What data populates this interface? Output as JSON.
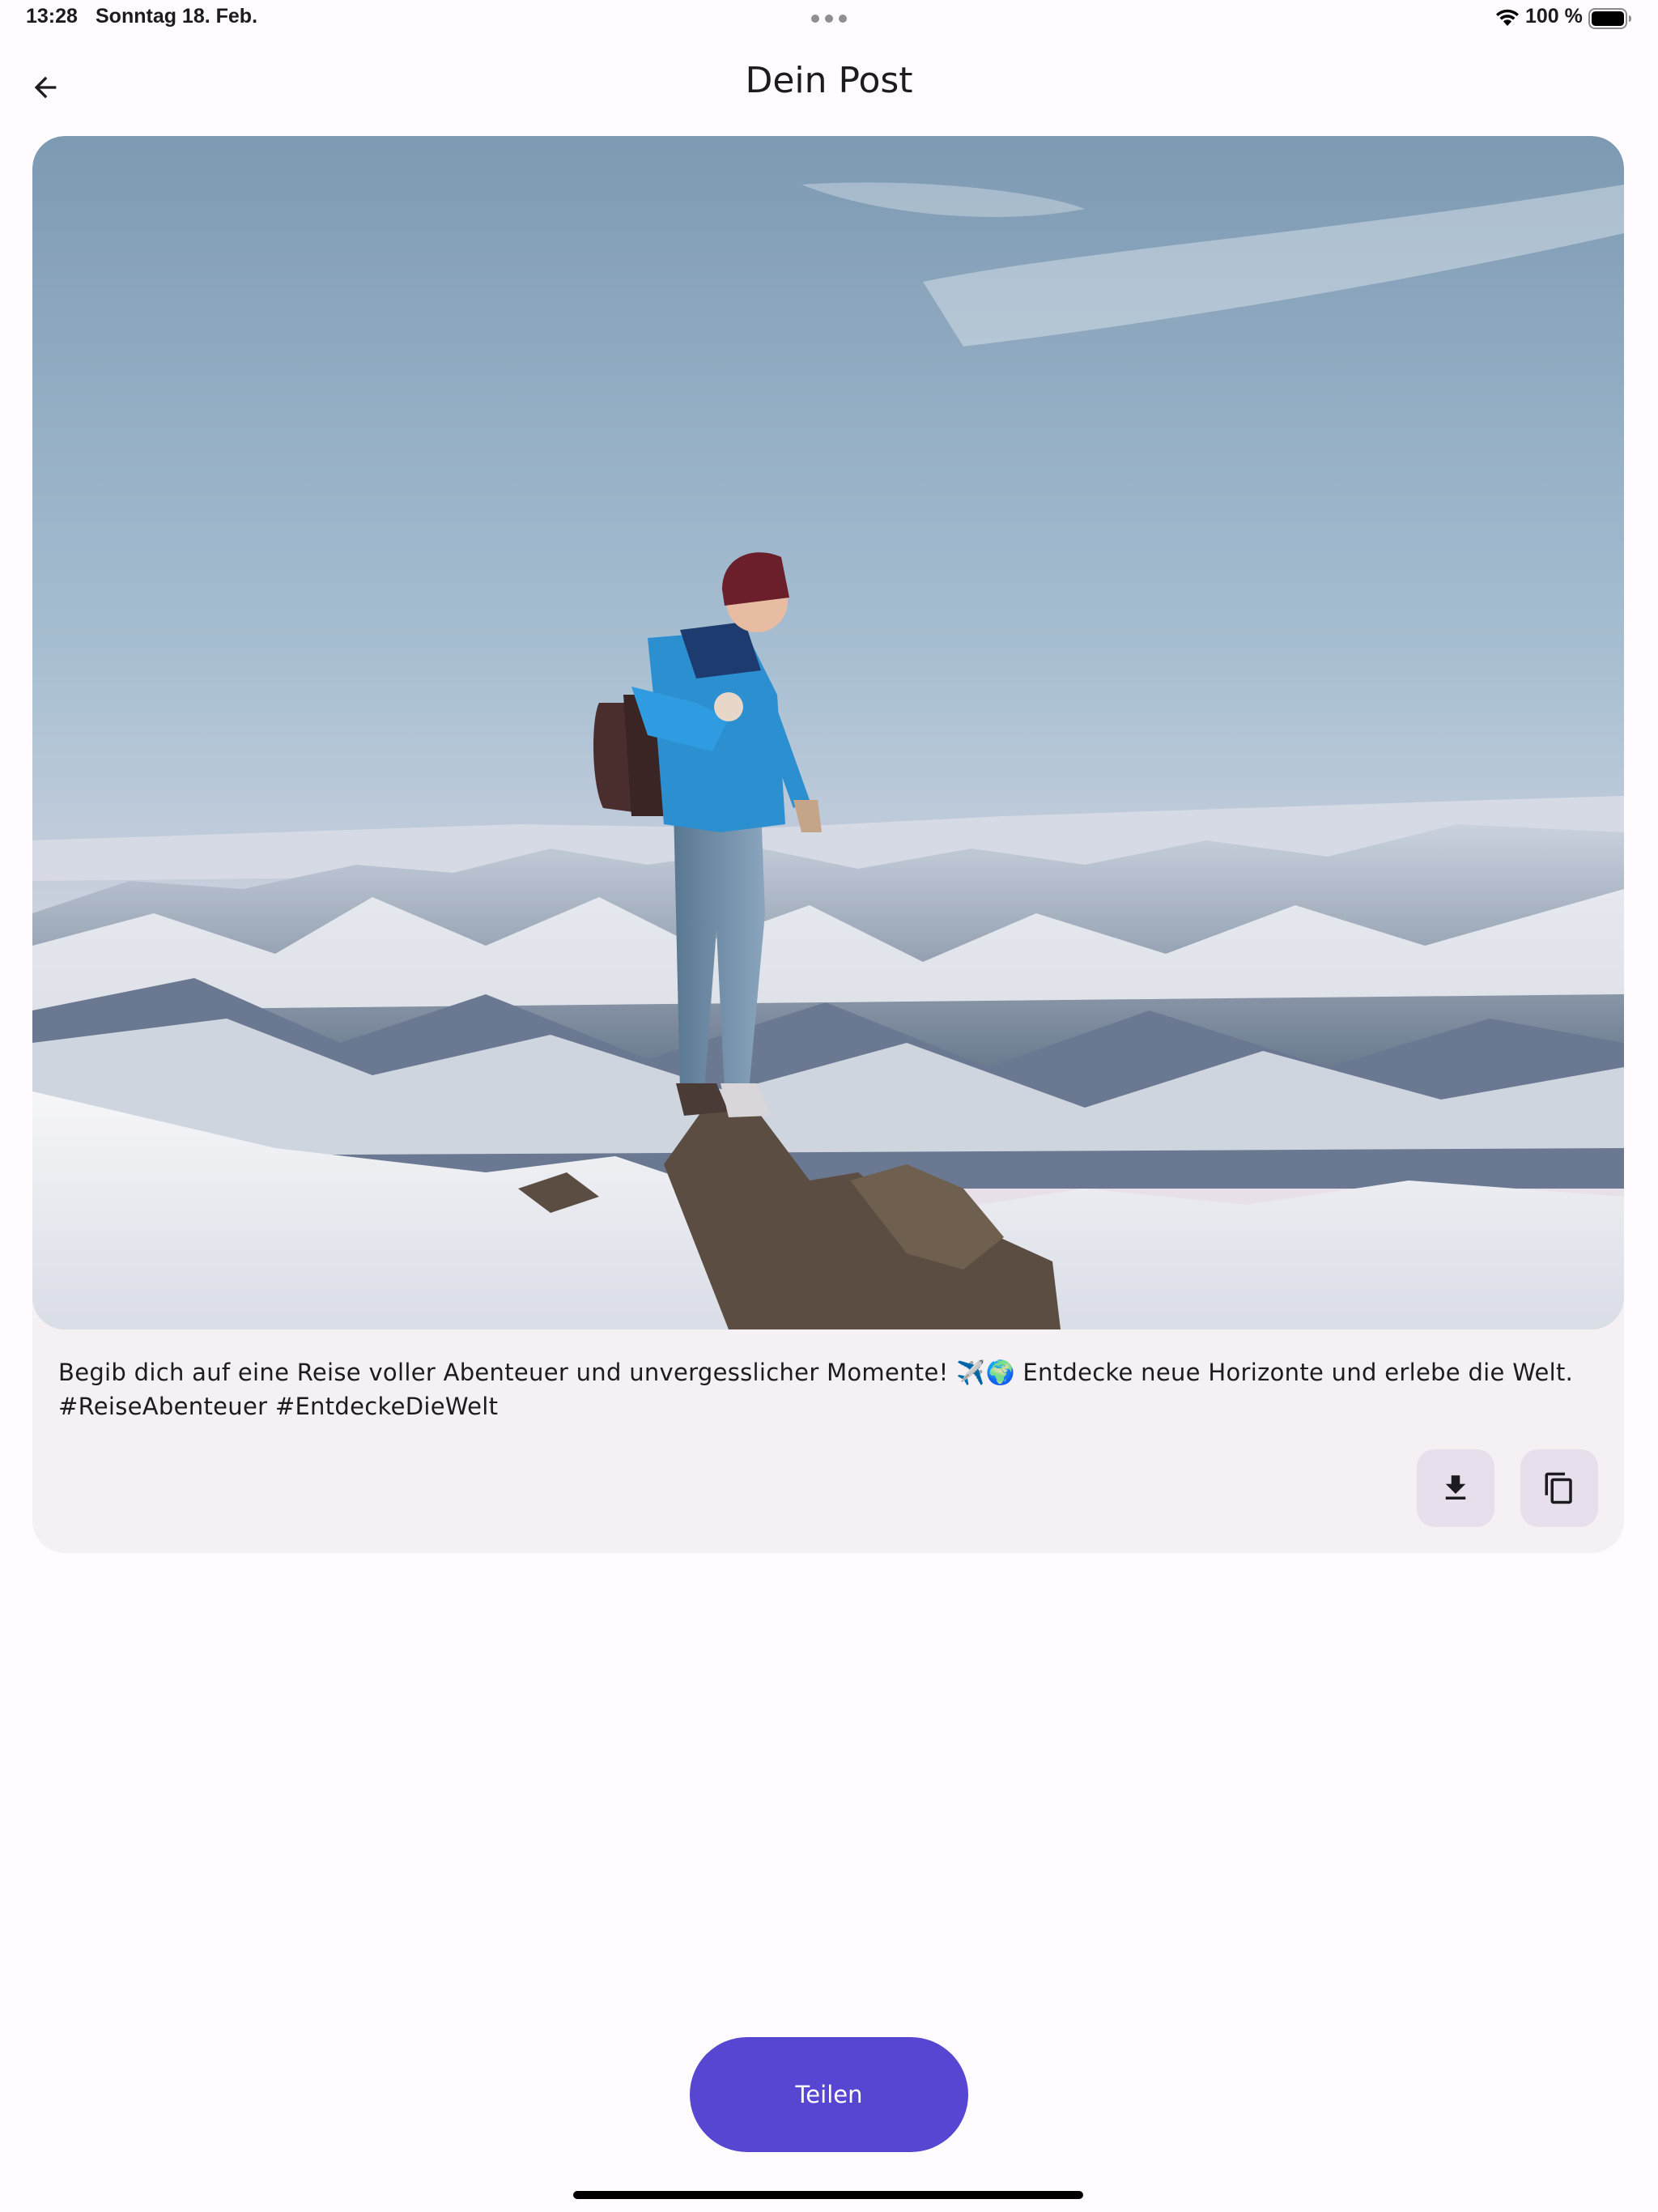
{
  "status_bar": {
    "time": "13:28",
    "date": "Sonntag 18. Feb.",
    "battery": "100 %",
    "icons": [
      "multitask-dots-icon",
      "wifi-icon",
      "battery-icon"
    ]
  },
  "app_bar": {
    "back_icon": "arrow-left-icon",
    "title": "Dein Post"
  },
  "post": {
    "image_subject": "hiker-on-snowy-mountain-peak",
    "caption": "Begib dich auf eine Reise voller Abenteuer und unvergesslicher Momente! ✈️🌍  Entdecke neue Horizonte und erlebe die Welt.\n#ReiseAbenteuer #EntdeckeDieWelt",
    "actions": [
      {
        "icon": "download-icon"
      },
      {
        "icon": "copy-icon"
      }
    ]
  },
  "share": {
    "label": "Teilen"
  },
  "colors": {
    "background": "#fffbfe",
    "card": "#f4f0f4",
    "action_button": "#e7e0ec",
    "primary": "#5646d1"
  }
}
